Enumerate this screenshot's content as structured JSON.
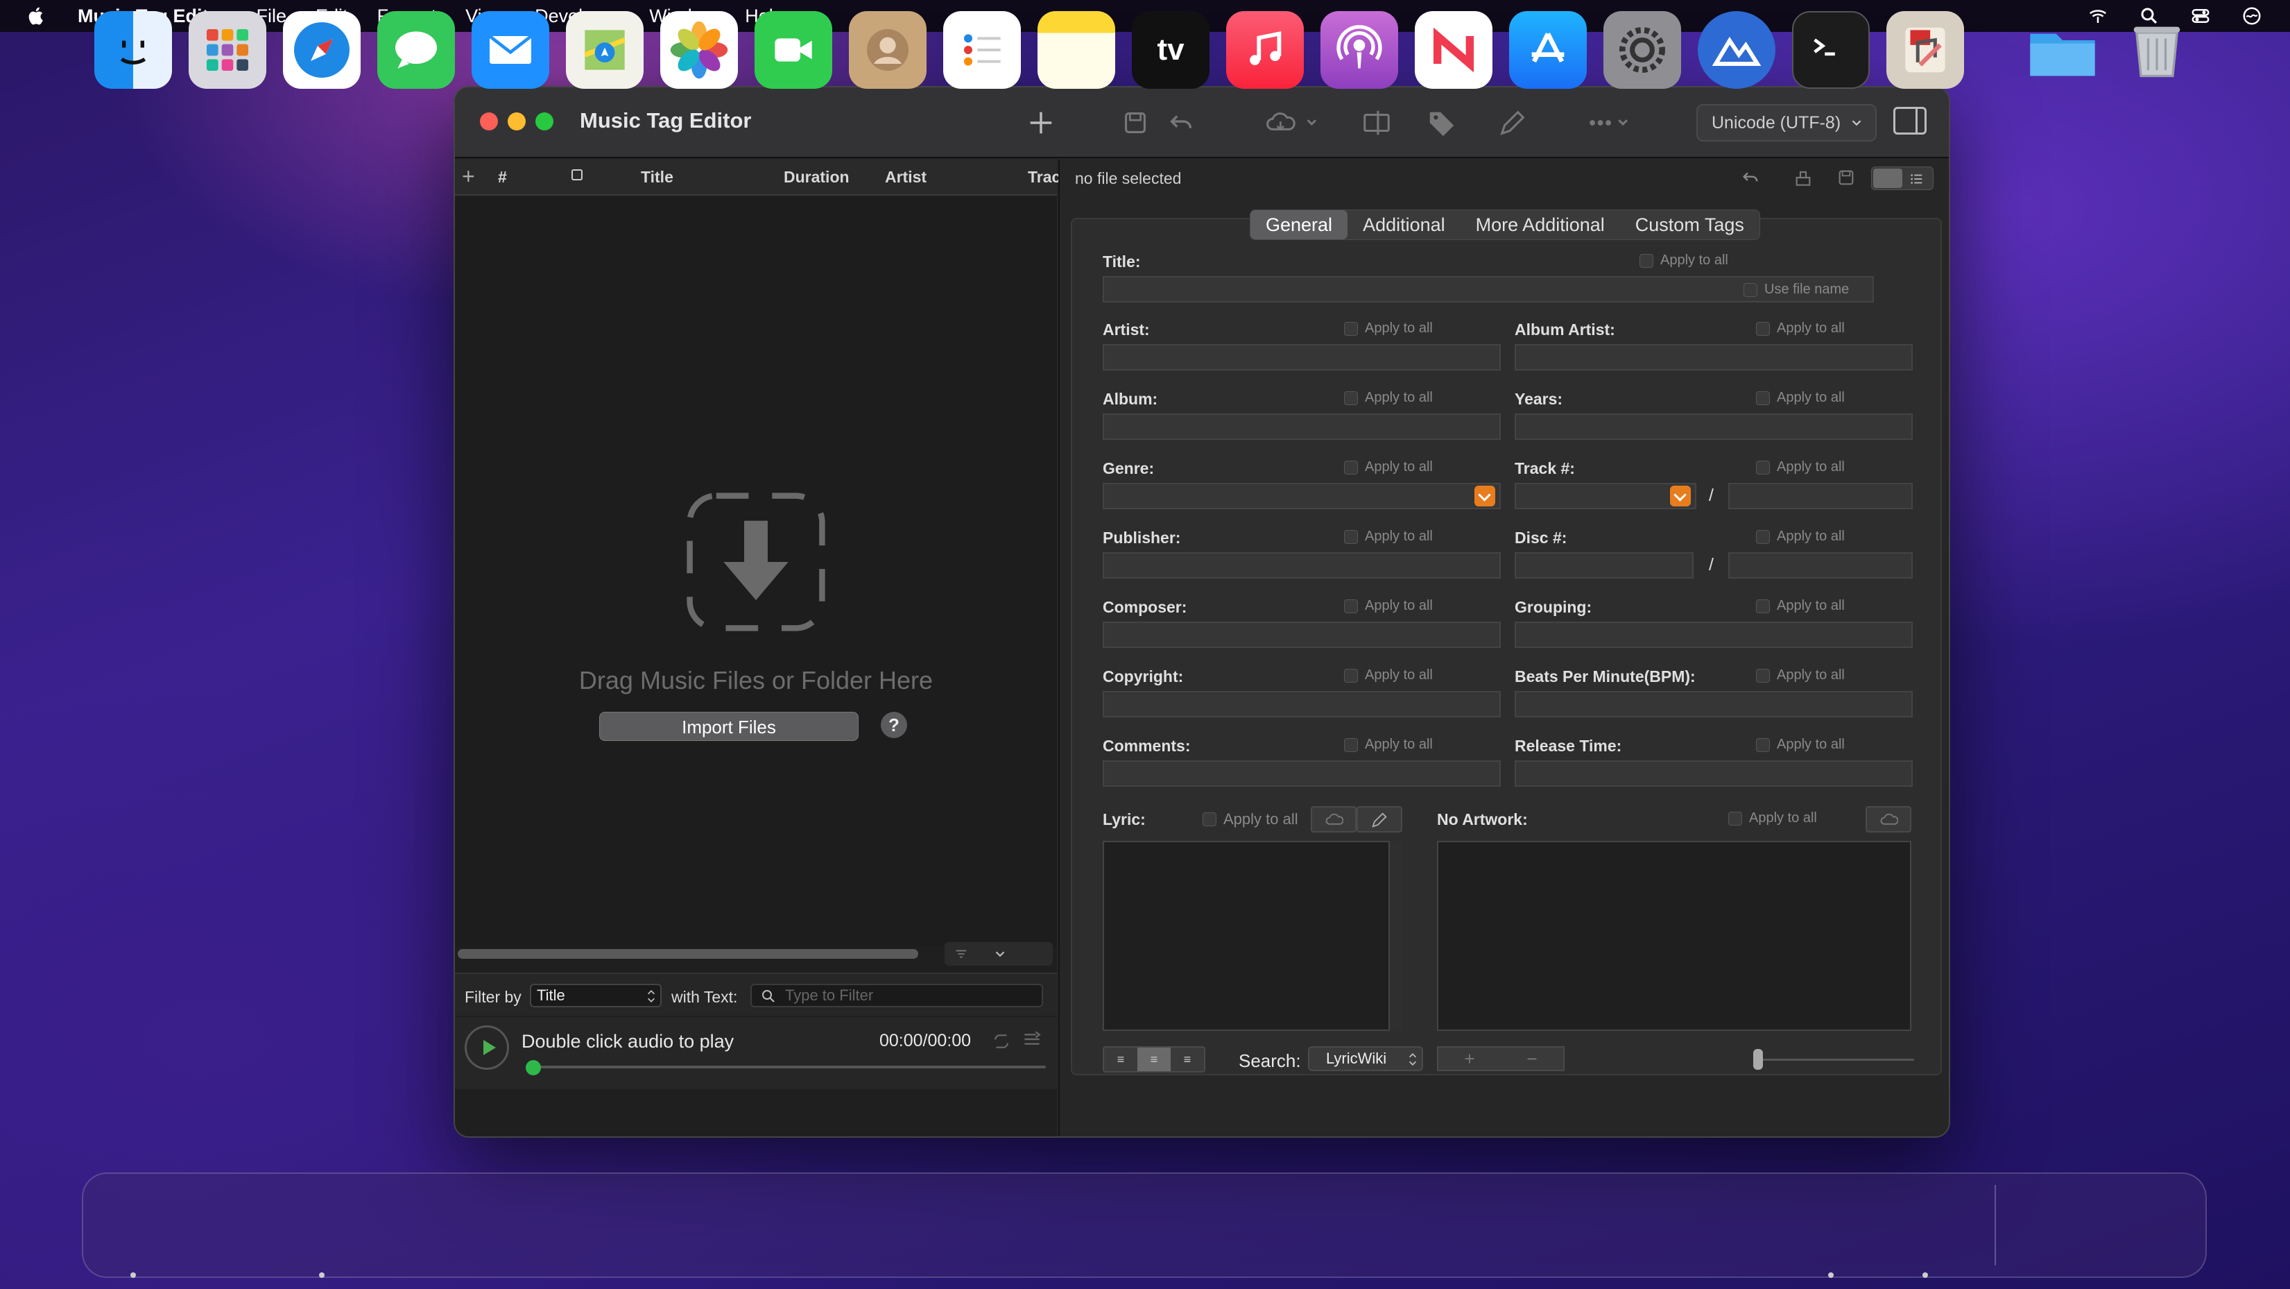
{
  "menubar": {
    "app_name": "Music Tag Editor",
    "items": [
      "File",
      "Edit",
      "Format",
      "View",
      "Developer",
      "Window",
      "Help"
    ]
  },
  "window": {
    "title": "Music Tag Editor",
    "encoding": "Unicode (UTF-8)"
  },
  "track_list": {
    "columns": [
      "#",
      "Title",
      "Duration",
      "Artist",
      "Trac"
    ],
    "drop_text": "Drag Music Files or Folder Here",
    "import_label": "Import Files",
    "help_label": "?"
  },
  "filter": {
    "filter_by_label": "Filter by",
    "filter_by_value": "Title",
    "with_text_label": "with Text:",
    "placeholder": "Type to Filter"
  },
  "player": {
    "message": "Double click audio to play",
    "time": "00:00/00:00",
    "progress": 0
  },
  "editor": {
    "status": "no file selected",
    "tabs": [
      "General",
      "Additional",
      "More Additional",
      "Custom Tags"
    ],
    "active_tab": "General",
    "apply_to_all": "Apply to all",
    "use_file_name": "Use file name",
    "fields": {
      "title": "Title:",
      "artist": "Artist:",
      "album_artist": "Album Artist:",
      "album": "Album:",
      "years": "Years:",
      "genre": "Genre:",
      "track": "Track #:",
      "publisher": "Publisher:",
      "disc": "Disc #:",
      "composer": "Composer:",
      "grouping": "Grouping:",
      "copyright": "Copyright:",
      "bpm": "Beats Per Minute(BPM):",
      "comments": "Comments:",
      "release_time": "Release Time:",
      "lyric": "Lyric:",
      "artwork": "No Artwork:"
    },
    "slash": "/",
    "search_label": "Search:",
    "search_source": "LyricWiki",
    "accent_color": "#e87d1e"
  },
  "dock": {
    "apps": [
      "finder",
      "launchpad",
      "safari",
      "messages",
      "mail",
      "maps",
      "photos",
      "facetime",
      "contacts",
      "reminders",
      "notes",
      "tv",
      "music",
      "podcasts",
      "news",
      "app-store",
      "system-preferences",
      "altitude",
      "terminal",
      "music-tag-editor",
      "folder",
      "trash"
    ],
    "tv_label": "tv"
  }
}
